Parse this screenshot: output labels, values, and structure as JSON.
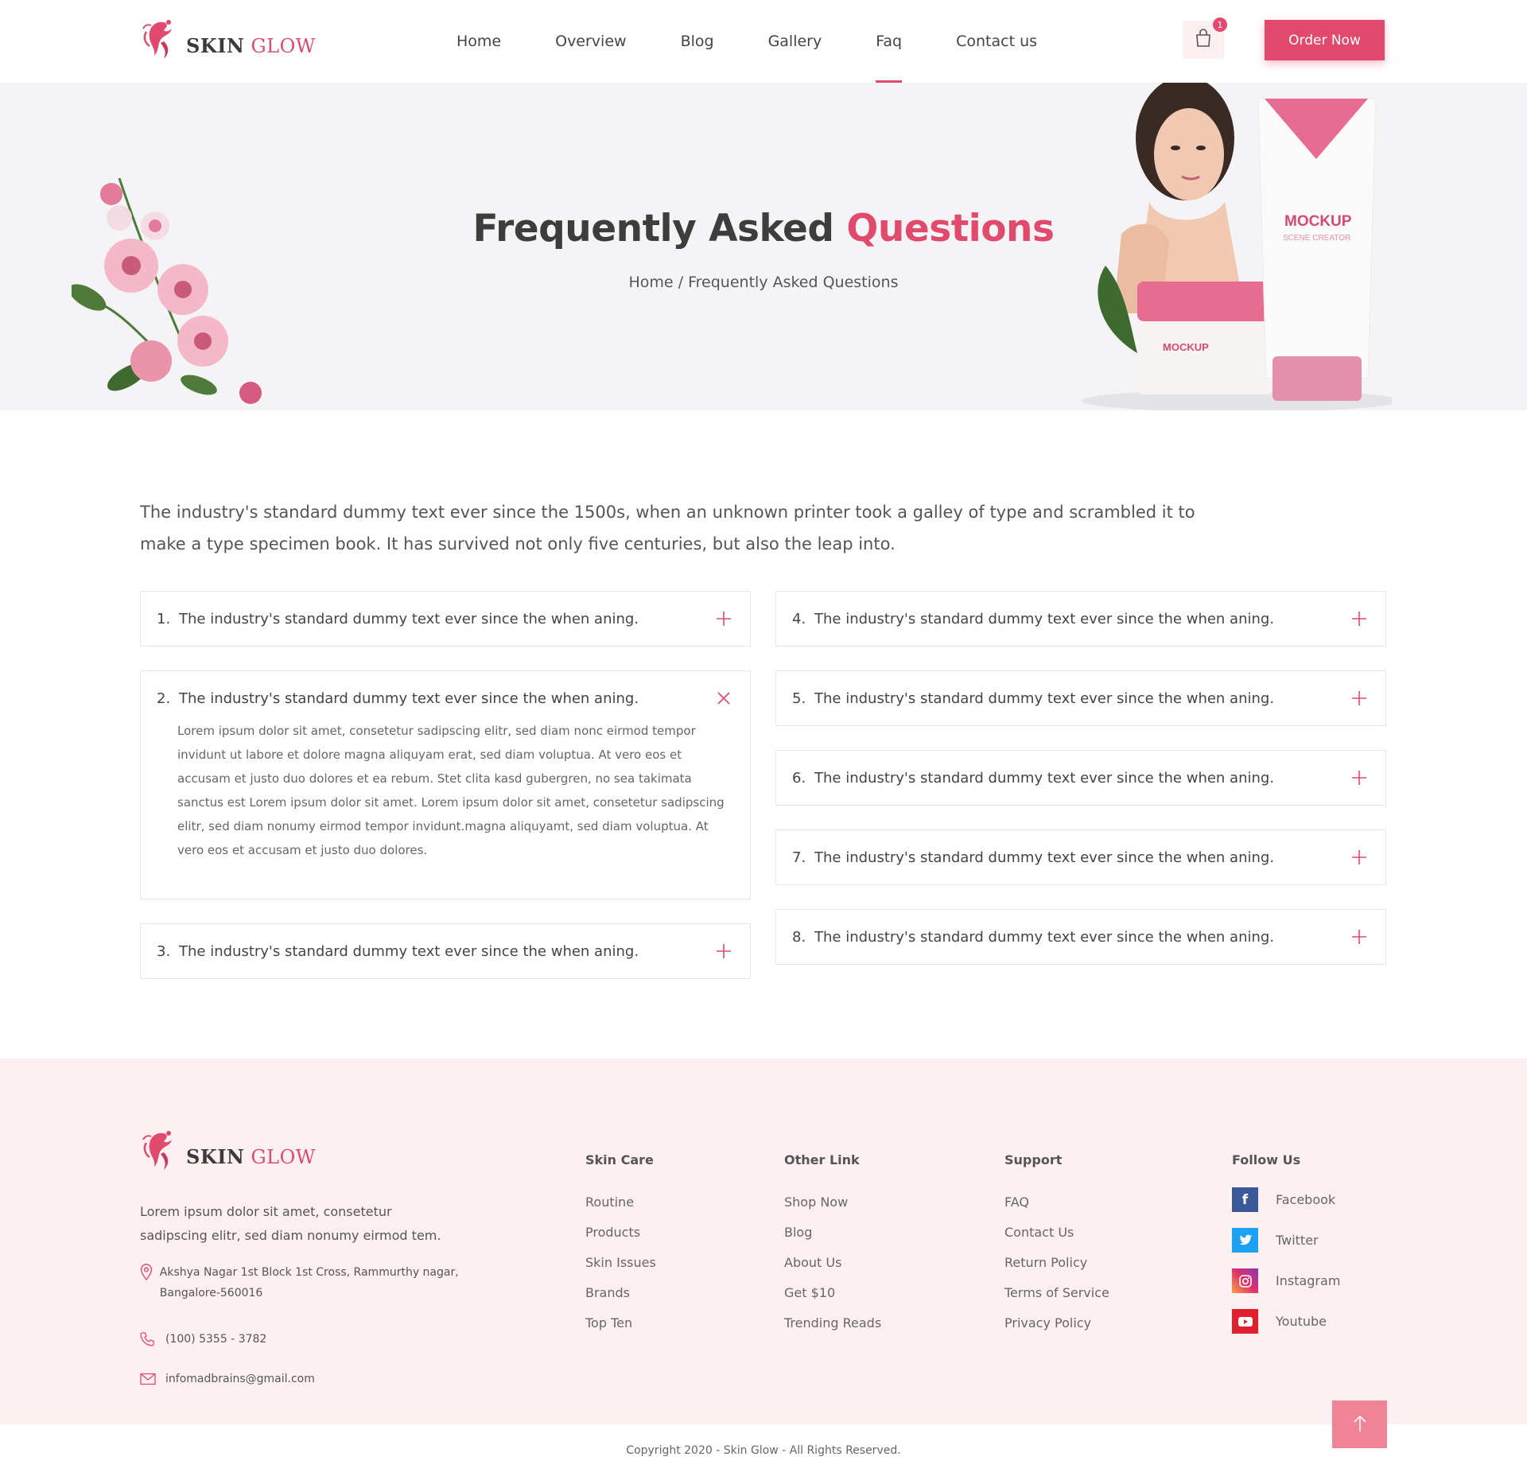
{
  "brand": {
    "word1": "SKIN",
    "word2": "GLOW"
  },
  "nav": [
    {
      "label": "Home"
    },
    {
      "label": "Overview"
    },
    {
      "label": "Blog"
    },
    {
      "label": "Gallery"
    },
    {
      "label": "Faq"
    },
    {
      "label": "Contact us"
    }
  ],
  "nav_active_index": 4,
  "cart": {
    "count": "1"
  },
  "order_button": "Order Now",
  "hero": {
    "title_part1": "Frequently Asked",
    "title_part2": "Questions",
    "breadcrumb": "Home / Frequently Asked Questions",
    "product_label_1": "MOCKUP",
    "product_label_2": "SCENE CREATOR"
  },
  "intro": "The industry's standard dummy text ever since the 1500s, when an unknown printer took a galley of type and scrambled it to make a type specimen book. It has survived not only five centuries, but also the leap into.",
  "faq": {
    "left": [
      {
        "num": "1.",
        "question": "The industry's standard dummy text ever since the when aning.",
        "open": false
      },
      {
        "num": "2.",
        "question": "The industry's standard dummy text ever since the when aning.",
        "open": true,
        "answer": "Lorem ipsum dolor sit amet, consetetur sadipscing elitr, sed diam nonc eirmod tempor invidunt ut labore et dolore magna aliquyam erat, sed diam voluptua. At vero eos et accusam et justo duo dolores et ea rebum. Stet clita kasd gubergren, no sea takimata sanctus est Lorem ipsum dolor sit amet. Lorem ipsum dolor sit amet, consetetur sadipscing elitr, sed diam nonumy eirmod tempor invidunt.magna aliquyamt, sed diam voluptua. At vero eos et accusam et justo duo dolores."
      },
      {
        "num": "3.",
        "question": "The industry's standard dummy text ever since the when aning.",
        "open": false
      }
    ],
    "right": [
      {
        "num": "4.",
        "question": "The industry's standard dummy text ever since the when aning.",
        "open": false
      },
      {
        "num": "5.",
        "question": "The industry's standard dummy text ever since the when aning.",
        "open": false
      },
      {
        "num": "6.",
        "question": "The industry's standard dummy text ever since the when aning.",
        "open": false
      },
      {
        "num": "7.",
        "question": "The industry's standard dummy text ever since the when aning.",
        "open": false
      },
      {
        "num": "8.",
        "question": "The industry's standard dummy text ever since the when aning.",
        "open": false
      }
    ]
  },
  "footer": {
    "description": "Lorem ipsum dolor sit amet, consetetur sadipscing elitr, sed diam nonumy eirmod tem.",
    "address": "Akshya Nagar 1st Block 1st Cross, Rammurthy nagar, Bangalore-560016",
    "phone": "(100) 5355 - 3782",
    "email": "infomadbrains@gmail.com",
    "columns": {
      "skin_care": {
        "title": "Skin Care",
        "links": [
          "Routine",
          "Products",
          "Skin Issues",
          "Brands",
          "Top Ten"
        ]
      },
      "other_link": {
        "title": "Other Link",
        "links": [
          "Shop Now",
          "Blog",
          "About Us",
          "Get $10",
          "Trending Reads"
        ]
      },
      "support": {
        "title": "Support",
        "links": [
          "FAQ",
          "Contact Us",
          "Return Policy",
          "Terms of Service",
          "Privacy Policy"
        ]
      },
      "follow": {
        "title": "Follow Us",
        "links": [
          {
            "label": "Facebook",
            "icon": "facebook-icon",
            "color": "#3b5998"
          },
          {
            "label": "Twitter",
            "icon": "twitter-icon",
            "color": "#1da1f2"
          },
          {
            "label": "Instagram",
            "icon": "instagram-icon",
            "color": "#e1306c"
          },
          {
            "label": "Youtube",
            "icon": "youtube-icon",
            "color": "#e0202a"
          }
        ]
      }
    },
    "copyright": "Copyright 2020 - Skin Glow - All Rights Reserved."
  },
  "colors": {
    "accent": "#e14a6c",
    "hero_bg": "#f4f4f6",
    "footer_bg": "#fdf0f2",
    "to_top": "#f08496"
  }
}
